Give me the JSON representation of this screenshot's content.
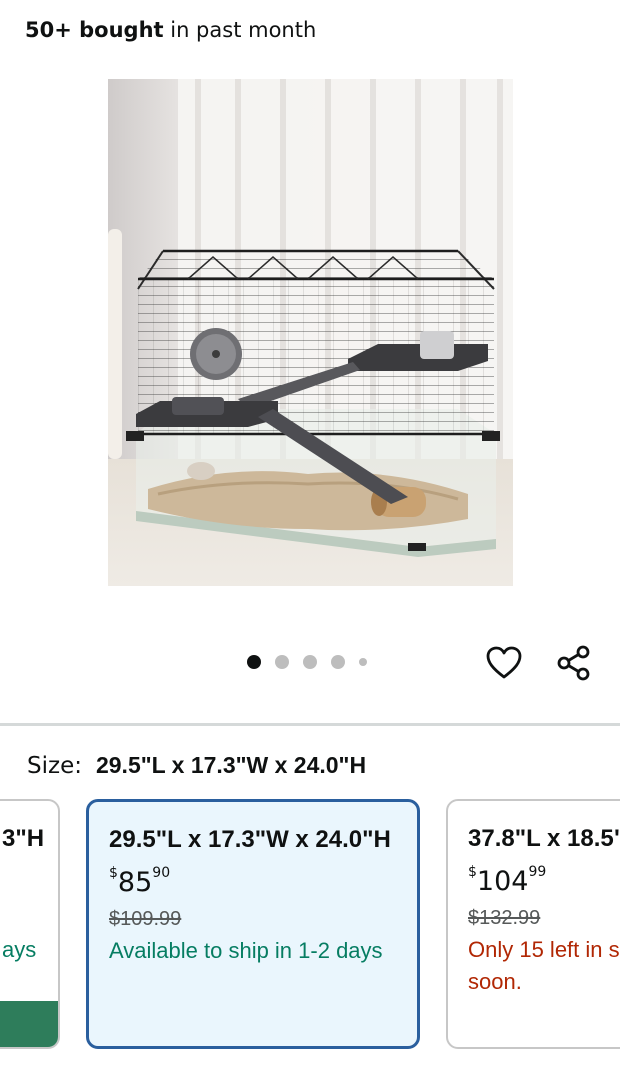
{
  "header": {
    "bought_bold": "50+ bought",
    "bought_rest": " in past month"
  },
  "image": {
    "alt": "Product image: wire hamster cage with glass base, two platforms, exercise wheel and ramp",
    "carousel_total": 5,
    "carousel_active": 1
  },
  "actions": {
    "favorite_icon": "heart-outline-icon",
    "share_icon": "share-icon"
  },
  "size": {
    "label": "Size:",
    "selected_value": "29.5\"L x 17.3\"W x 24.0\"H"
  },
  "size_options": {
    "left": {
      "title_partial": "3\"H",
      "availability_partial": "ays"
    },
    "middle": {
      "title": "29.5\"L x 17.3\"W x 24.0\"H",
      "price_dollar_sign": "$",
      "price_whole": "85",
      "price_cents": "90",
      "list_price": "$109.99",
      "availability": "Available to ship in 1-2 days"
    },
    "right": {
      "title": "37.8\"L x 18.5\"",
      "price_dollar_sign": "$",
      "price_whole": "104",
      "price_cents": "99",
      "list_price": "$132.99",
      "availability_line1": "Only 15 left in s",
      "availability_line2": "soon."
    }
  },
  "colors": {
    "selected_border": "#2a5f9e",
    "selected_bg": "#eaf6fd",
    "available_green": "#067d62",
    "low_stock_red": "#b12704"
  }
}
